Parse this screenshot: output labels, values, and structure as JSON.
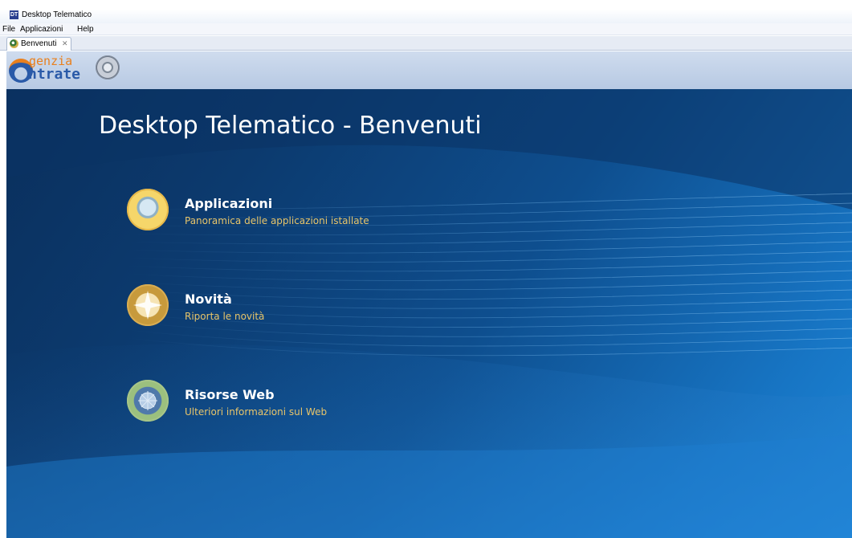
{
  "window": {
    "app_icon": "DT",
    "title": "Desktop Telematico"
  },
  "menubar": {
    "items": [
      "File",
      "Applicazioni",
      "Help"
    ]
  },
  "tabs": [
    {
      "label": "Benvenuti",
      "icon": "agency-emblem-icon",
      "close": "✕"
    }
  ],
  "logo": {
    "line1": "genzia",
    "line2": "ntrate"
  },
  "welcome": {
    "title": "Desktop Telematico - Benvenuti",
    "entries": [
      {
        "title": "Applicazioni",
        "description": "Panoramica delle applicazioni istallate",
        "icon": "globe-icon"
      },
      {
        "title": "Novità",
        "description": "Riporta le novità",
        "icon": "star-icon"
      },
      {
        "title": "Risorse Web",
        "description": "Ulteriori informazioni sul Web",
        "icon": "web-icon"
      }
    ]
  },
  "colors": {
    "background_dark": "#0a2f5c",
    "background_light": "#1d86d6",
    "description_text": "#e8c56a",
    "logo_orange": "#e9801e",
    "logo_blue": "#2a5aa8"
  }
}
